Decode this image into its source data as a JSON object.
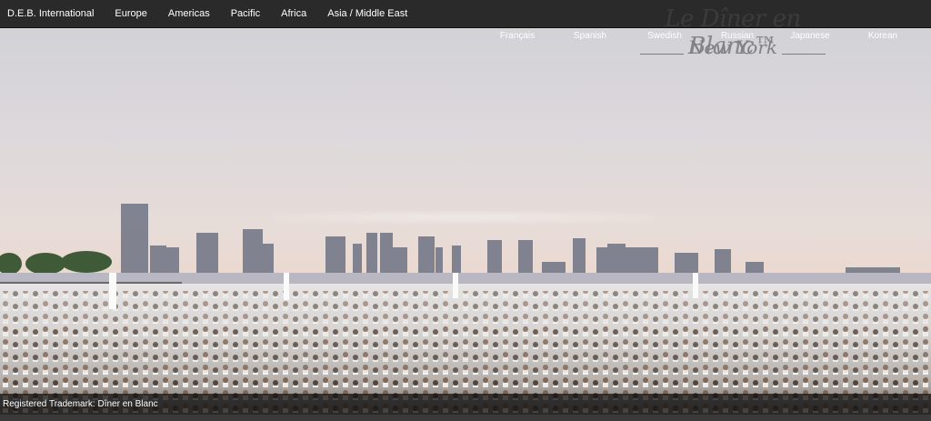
{
  "nav": {
    "items": [
      "D.E.B. International",
      "Europe",
      "Americas",
      "Pacific",
      "Africa",
      "Asia / Middle East"
    ]
  },
  "logo": {
    "wordmark": "Le Dîner en Blanc™",
    "city": "New York"
  },
  "languages": [
    "Français",
    "Spanish",
    "Swedish",
    "Russian",
    "Japanese",
    "Korean"
  ],
  "footer": {
    "trademark": "Registered Trademark: Dîner en Blanc"
  },
  "colors": {
    "nav_bg": "#2a2a2a",
    "tab_bg": "#3b3b3b",
    "sky_top": "#cfd0d6",
    "sky_horizon": "#f2c9b0"
  }
}
